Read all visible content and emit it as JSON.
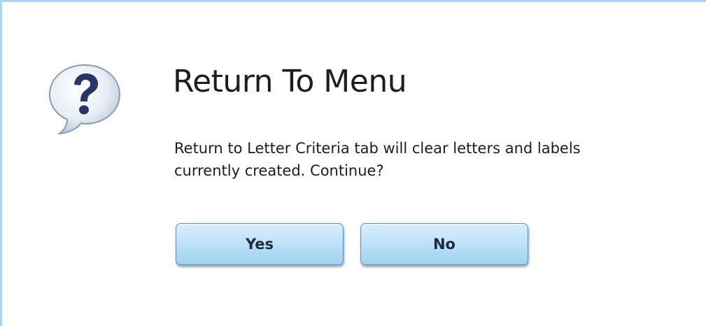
{
  "dialog": {
    "title": "Return To Menu",
    "message": "Return to Letter Criteria tab will clear letters and labels currently created. Continue?",
    "icon": "question-bubble-icon",
    "buttons": {
      "yes_label": "Yes",
      "no_label": "No"
    }
  },
  "colors": {
    "border": "#a9d4f2",
    "button_top": "#d9efff",
    "button_bottom": "#9fd1f2",
    "button_border": "#4b93c9",
    "icon_mark": "#2a3566"
  }
}
